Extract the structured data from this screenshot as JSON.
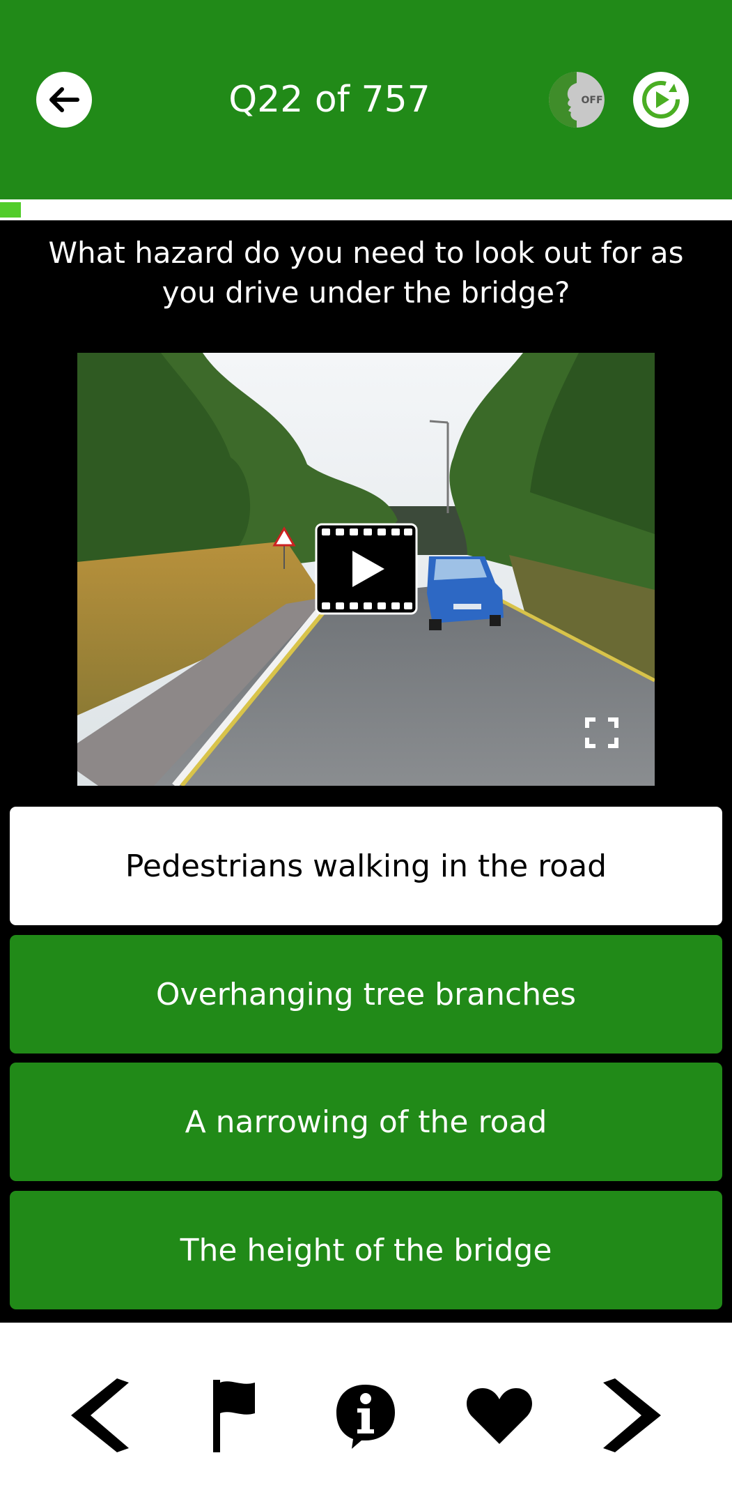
{
  "header": {
    "title": "Q22 of 757",
    "voice_toggle_label": "OFF",
    "back_icon": "arrow-left-icon",
    "replay_icon": "replay-icon",
    "background_color": "#218a18"
  },
  "progress": {
    "current": 22,
    "total": 757,
    "fraction": 0.029
  },
  "question": {
    "text": "What hazard do you need to look out for as you drive under the bridge?"
  },
  "video": {
    "play_icon": "film-play-icon",
    "fullscreen_icon": "fullscreen-icon"
  },
  "answers": [
    {
      "label": "Pedestrians walking in the road",
      "selected": true
    },
    {
      "label": "Overhanging tree branches",
      "selected": false
    },
    {
      "label": "A narrowing of the road",
      "selected": false
    },
    {
      "label": "The height of the bridge",
      "selected": false
    }
  ],
  "bottom_nav": {
    "items": [
      "previous-icon",
      "flag-icon",
      "info-icon",
      "favorite-icon",
      "next-icon"
    ]
  },
  "colors": {
    "accent": "#218a18",
    "progress": "#52cc2a",
    "selected_bg": "#ffffff"
  }
}
